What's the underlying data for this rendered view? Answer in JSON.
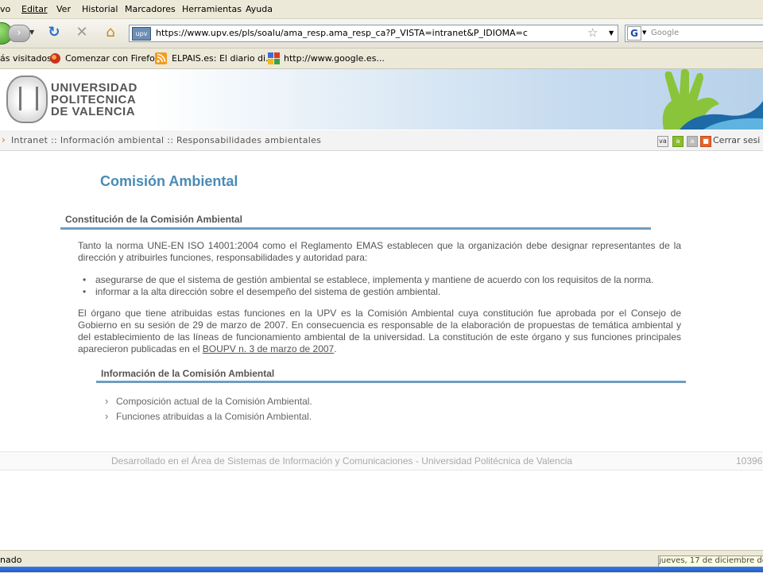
{
  "menu": [
    "vo",
    "Editar",
    "Ver",
    "Historial",
    "Marcadores",
    "Herramientas",
    "Ayuda"
  ],
  "navbar": {
    "site_badge": "upv",
    "url": "https://www.upv.es/pls/soalu/ama_resp.ama_resp_ca?P_VISTA=intranet&P_IDIOMA=c",
    "search_placeholder": "Google",
    "search_engine_letter": "G"
  },
  "bookmarks": [
    "ás visitados",
    "Comenzar con Firefox",
    "ELPAIS.es: El diario di...",
    "http://www.google.es..."
  ],
  "banner": {
    "line1": "UNIVERSIDAD",
    "line2": "POLITECNICA",
    "line3": "DE VALENCIA"
  },
  "breadcrumb": {
    "text": "Intranet :: Información ambiental :: Responsabilidades ambientales",
    "close_label": "Cerrar sesi",
    "icons": [
      "va",
      "a",
      "a"
    ]
  },
  "page": {
    "title": "Comisión Ambiental",
    "section1": {
      "heading": "Constitución de la Comisión Ambiental",
      "para1": "Tanto la norma UNE-EN ISO 14001:2004 como el Reglamento EMAS establecen que la organización debe designar representantes de la dirección y atribuirles funciones, responsabilidades y autoridad para:",
      "bullets": [
        "asegurarse de que el sistema de gestión ambiental se establece, implementa y mantiene de acuerdo con los requisitos de la norma.",
        "informar a la alta dirección sobre el desempeño del sistema de gestión ambiental."
      ],
      "para2": "El órgano que tiene atribuidas estas funciones en la UPV es la Comisión Ambiental cuya constitución fue aprobada por el Consejo de Gobierno en su sesión de 29 de marzo de 2007. En consecuencia es responsable de la elaboración de propuestas de temática ambiental y del establecimiento de las líneas de funcionamiento ambiental de la universidad. La constitución de este órgano y sus funciones principales aparecieron publicadas en el ",
      "para2_link": "BOUPV n. 3 de marzo de 2007",
      "para2_end": "."
    },
    "section2": {
      "heading": "Información de la Comisión Ambiental",
      "links": [
        "Composición actual de la Comisión Ambiental.",
        "Funciones atribuidas a la Comisión Ambiental."
      ]
    }
  },
  "footer": {
    "text": "Desarrollado en el Área de Sistemas de Información y Comunicaciones - Universidad Politécnica de Valencia",
    "number": "10396"
  },
  "status": {
    "text": "nado",
    "tooltip": "jueves, 17 de diciembre de"
  },
  "colors": {
    "accent": "#4a8ab6",
    "rule": "#6f9dc0",
    "arrow": "#e8632c"
  }
}
